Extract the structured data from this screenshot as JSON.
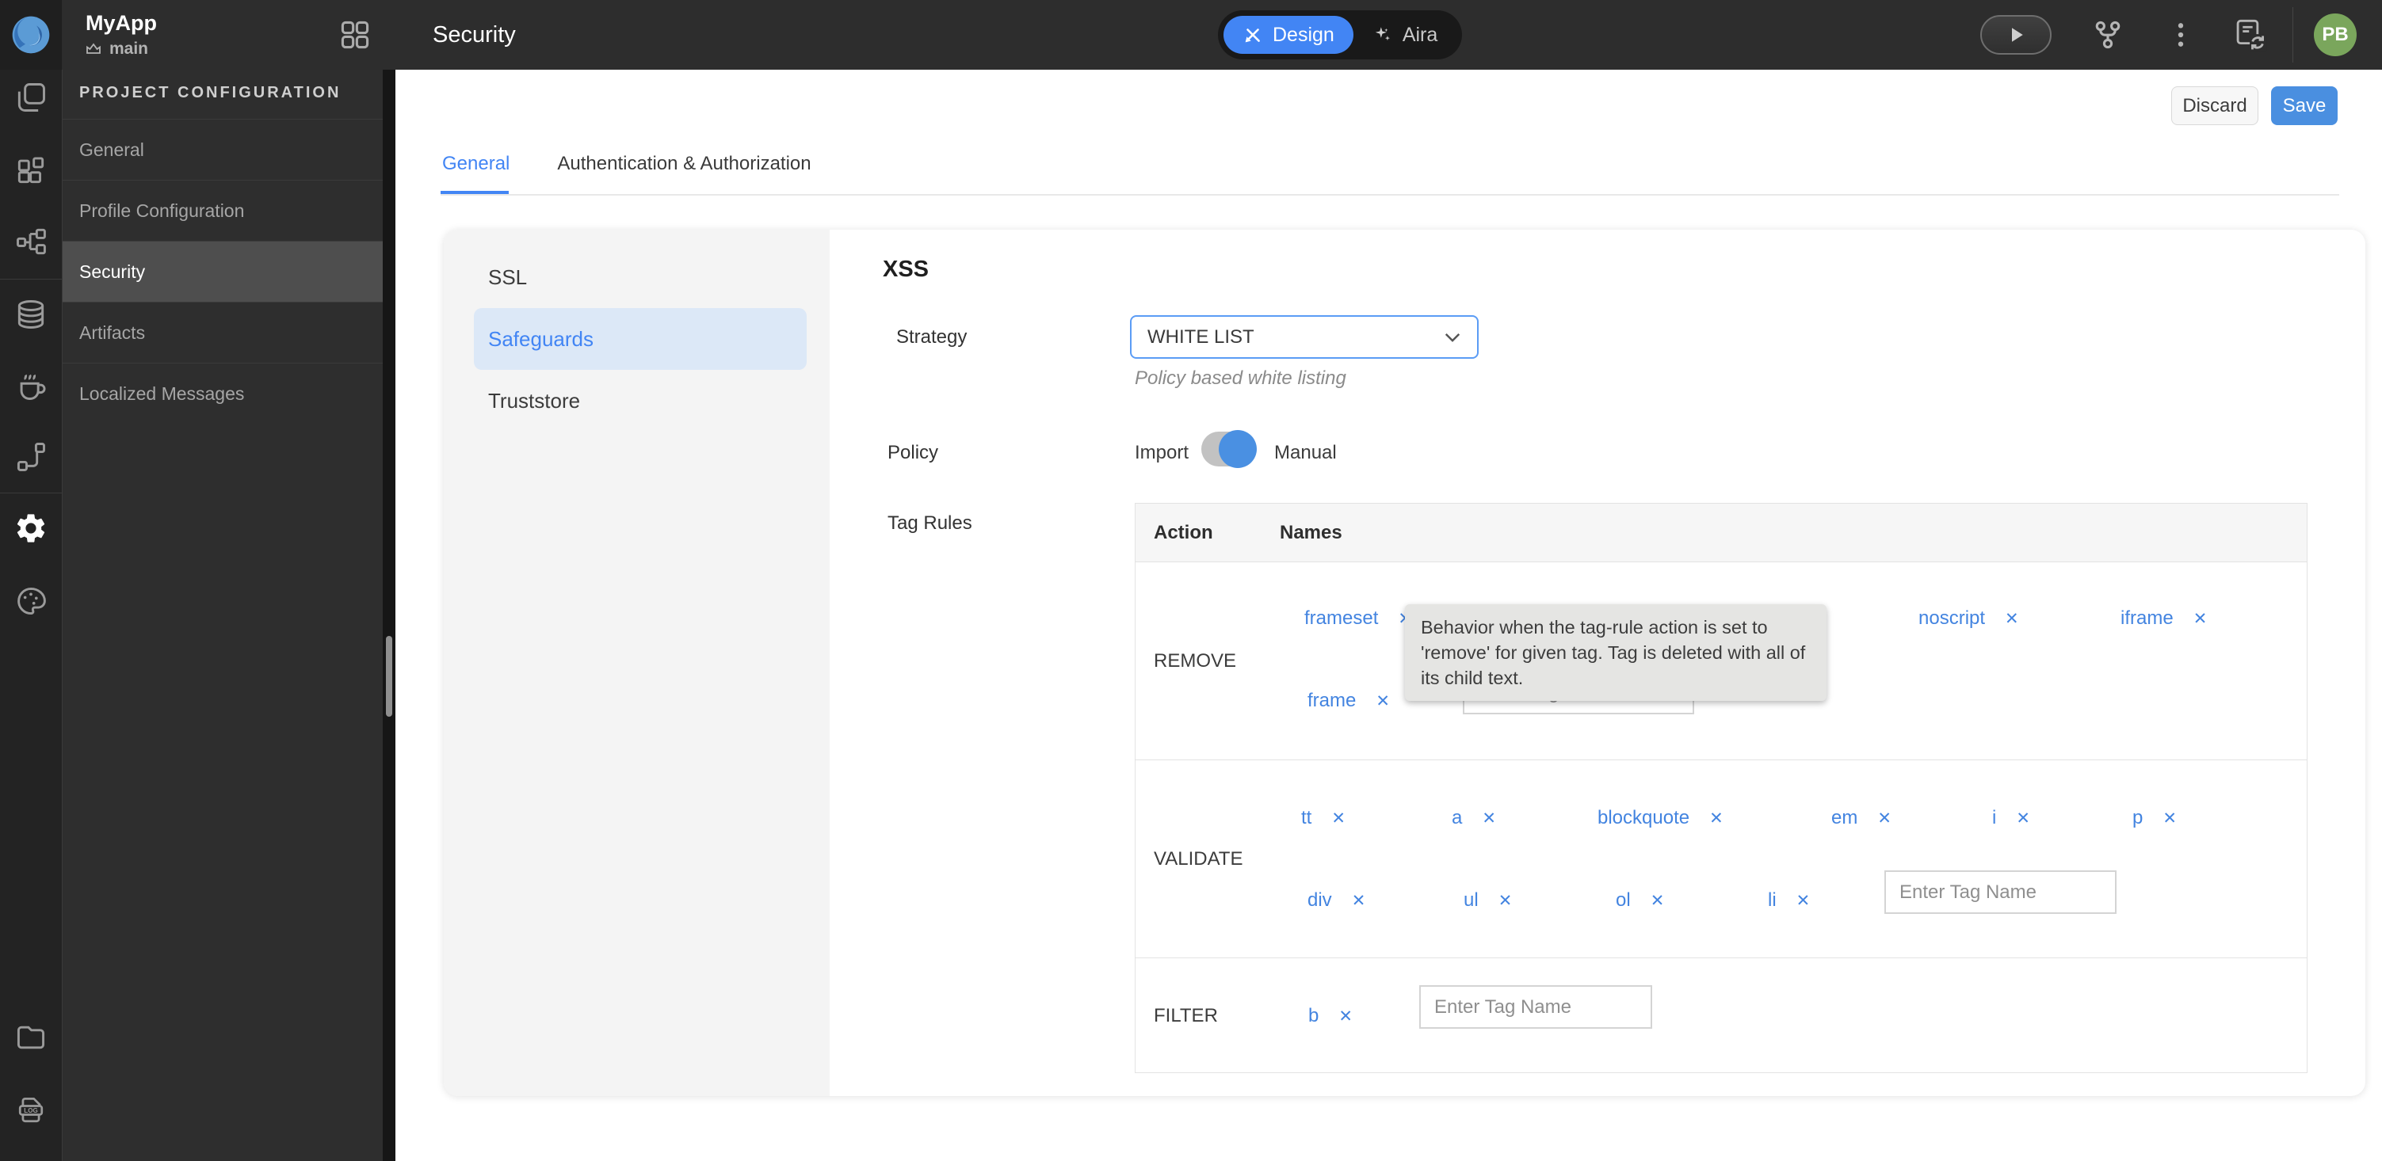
{
  "topbar": {
    "app_name": "MyApp",
    "branch": "main",
    "page_title": "Security",
    "modes": {
      "design": "Design",
      "aira": "Aira"
    },
    "avatar_initials": "PB"
  },
  "project_config": {
    "header": "PROJECT CONFIGURATION",
    "items": [
      "General",
      "Profile Configuration",
      "Security",
      "Artifacts",
      "Localized Messages"
    ],
    "active_item": "Security"
  },
  "actions": {
    "discard": "Discard",
    "save": "Save"
  },
  "tabs": {
    "general": "General",
    "auth": "Authentication & Authorization",
    "active": "General"
  },
  "security_nav": {
    "items": [
      "SSL",
      "Safeguards",
      "Truststore"
    ],
    "active_item": "Safeguards"
  },
  "xss": {
    "title": "XSS",
    "strategy_label": "Strategy",
    "strategy_value": "WHITE LIST",
    "strategy_help": "Policy based white listing",
    "policy_label": "Policy",
    "policy_import": "Import",
    "policy_manual": "Manual",
    "policy_selected": "Manual",
    "tag_rules_label": "Tag Rules",
    "tag_input_placeholder": "Enter Tag Name",
    "tooltip": "Behavior when the tag-rule action is set to 'remove' for given tag. Tag is deleted with all of its child text.",
    "table": {
      "headers": {
        "action": "Action",
        "names": "Names"
      },
      "rows": [
        {
          "action": "REMOVE",
          "row1": [
            "frameset",
            "noscript",
            "iframe"
          ],
          "row2": [
            "frame"
          ]
        },
        {
          "action": "VALIDATE",
          "row1": [
            "tt",
            "a",
            "blockquote",
            "em",
            "i",
            "p"
          ],
          "row2": [
            "div",
            "ul",
            "ol",
            "li"
          ]
        },
        {
          "action": "FILTER",
          "row1": [
            "b"
          ],
          "row2": []
        }
      ]
    }
  },
  "colors": {
    "accent_blue": "#4285f4",
    "save_blue": "#4a8fe0",
    "avatar_green": "#7aa65c",
    "dark_bg": "#2d2d2d",
    "panel_gray": "#f4f4f4",
    "active_nav_bg": "#dce8f7"
  }
}
